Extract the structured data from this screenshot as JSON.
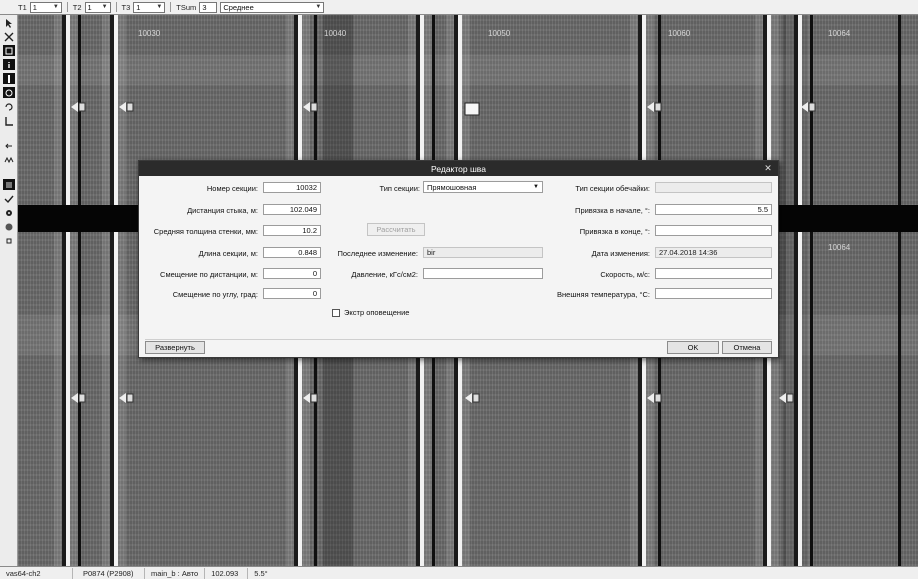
{
  "toolbar": {
    "t1_label": "T1",
    "t1_value": "1",
    "t2_label": "T2",
    "t2_value": "1",
    "t3_label": "T3",
    "t3_value": "1",
    "tsum_label": "TSum",
    "tsum_value": "3",
    "mode_value": "Среднее"
  },
  "scan": {
    "section_labels": [
      "10030",
      "10040",
      "10050",
      "10060",
      "10064"
    ],
    "lower_label": "10064"
  },
  "dialog": {
    "title": "Редактор шва",
    "section_number_label": "Номер секции:",
    "section_number_value": "10032",
    "joint_distance_label": "Дистанция стыка, м:",
    "joint_distance_value": "102.049",
    "avg_wall_label": "Средняя толщина стенки, мм:",
    "avg_wall_value": "10.2",
    "section_length_label": "Длина секции, м:",
    "section_length_value": "0.848",
    "dist_offset_label": "Смещение по дистанции, м:",
    "dist_offset_value": "0",
    "angle_offset_label": "Смещение по углу, град:",
    "angle_offset_value": "0",
    "section_type_label": "Тип секции:",
    "section_type_value": "Прямошовная",
    "recalc_button": "Рассчитать",
    "last_change_label": "Последнее изменение:",
    "last_change_value": "bir",
    "pressure_label": "Давление, кГс/см2:",
    "pressure_value": "",
    "shell_type_label": "Тип секции обечайки:",
    "shell_type_value": "",
    "weld_start_label": "Привязка в начале, °:",
    "weld_start_value": "5.5",
    "weld_end_label": "Привязка в конце, °:",
    "weld_end_value": "",
    "change_date_label": "Дата изменения:",
    "change_date_value": "27.04.2018 14:36",
    "speed_label": "Скорость, м/с:",
    "speed_value": "",
    "outer_temp_label": "Внешняя температура, °C:",
    "outer_temp_value": "",
    "express_alert_label": "Экстр оповещение",
    "expand_button": "Развернуть",
    "ok_button": "OK",
    "cancel_button": "Отмена"
  },
  "status": {
    "file": "vas64-ch2",
    "marker": "P0874 (P2908)",
    "channel": "main_b : Авто",
    "distance": "102.093",
    "angle": "5.5°"
  }
}
